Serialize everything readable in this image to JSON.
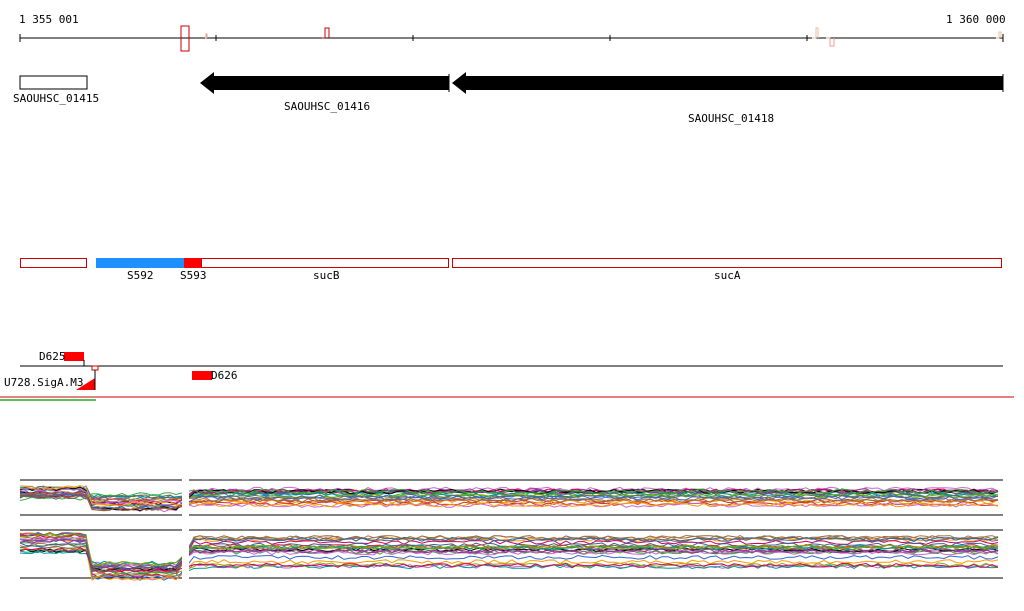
{
  "ruler": {
    "start_label": "1 355 001",
    "end_label": "1 360 000"
  },
  "genes": [
    {
      "id": "SAOUHSC_01415"
    },
    {
      "id": "SAOUHSC_01416"
    },
    {
      "id": "SAOUHSC_01418"
    }
  ],
  "features": [
    {
      "label": "S592"
    },
    {
      "label": "S593"
    },
    {
      "label": "sucB"
    },
    {
      "label": "sucA"
    }
  ],
  "elements": [
    {
      "label": "D625"
    },
    {
      "label": "U728.SigA.M3"
    },
    {
      "label": "D626"
    }
  ],
  "colors": {
    "gene_arrow": "#000000",
    "feature_outline": "#cc0000",
    "feature_blue": "#1e90ff",
    "feature_red": "#ff0000",
    "track_line_red": "#cc0000",
    "track_line_green": "#22aa22"
  }
}
